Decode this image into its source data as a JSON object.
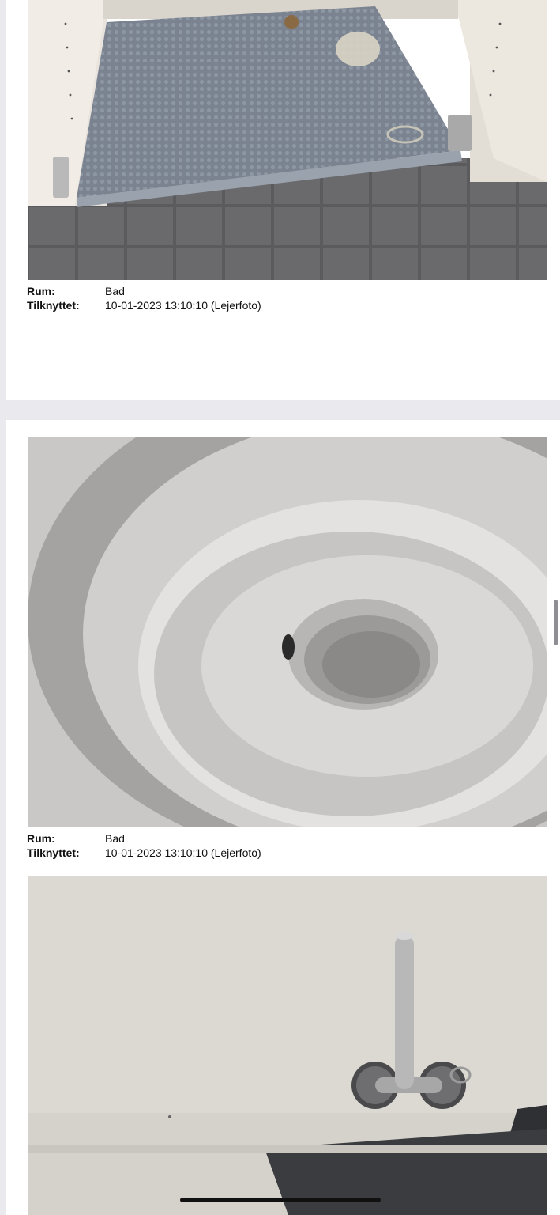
{
  "entries": [
    {
      "photo_icon": "cabinet-floor-photo",
      "room_label": "Rum:",
      "room_value": "Bad",
      "attached_label": "Tilknyttet:",
      "attached_value": "10-01-2023 13:10:10 (Lejerfoto)"
    },
    {
      "photo_icon": "toilet-bowl-photo",
      "room_label": "Rum:",
      "room_value": "Bad",
      "attached_label": "Tilknyttet:",
      "attached_value": "10-01-2023 13:10:10 (Lejerfoto)"
    },
    {
      "photo_icon": "toilet-paper-holder-photo"
    }
  ],
  "colors": {
    "background": "#e9e9ee",
    "page": "#ffffff",
    "text": "#111111"
  }
}
